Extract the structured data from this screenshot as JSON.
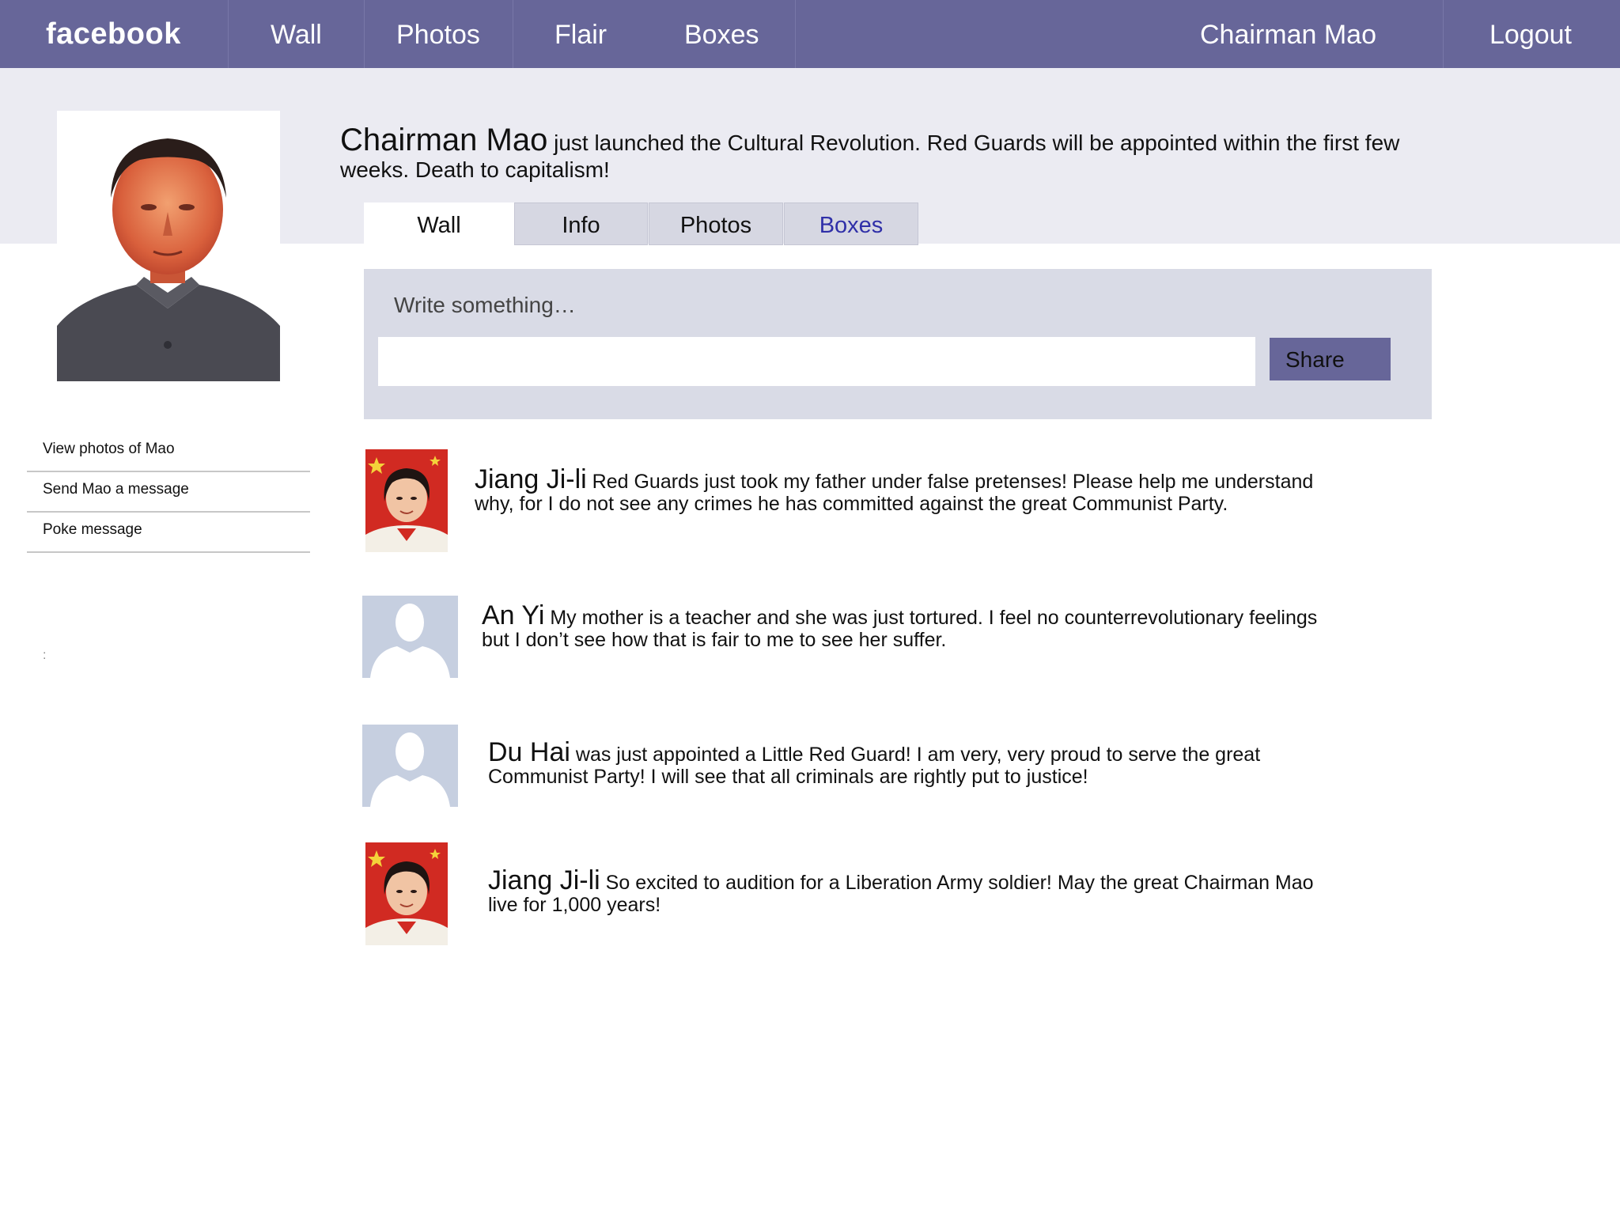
{
  "nav": {
    "logo": "facebook",
    "items": [
      "Wall",
      "Photos",
      "Flair",
      "Boxes"
    ],
    "user": "Chairman Mao",
    "logout": "Logout"
  },
  "profile": {
    "name": "Chairman Mao",
    "status": "just launched the Cultural Revolution. Red Guards will be appointed within the first few weeks. Death to capitalism!"
  },
  "tabs": [
    "Wall",
    "Info",
    "Photos",
    "Boxes"
  ],
  "sidebar": {
    "links": [
      "View photos of Mao",
      "Send Mao a message",
      "Poke message"
    ],
    "stray": ":"
  },
  "composer": {
    "label": "Write something…",
    "share": "Share"
  },
  "posts": [
    {
      "name": "Jiang Ji-li",
      "text": "Red Guards just took my father under false pretenses! Please help me understand why, for I do not see any crimes he has committed against the great Communist Party.",
      "avatar": "photo-avatar"
    },
    {
      "name": "An Yi",
      "text": "My mother is a teacher and she was just tortured. I feel no counterrevolutionary feelings but I don’t see how that is fair to me to see her suffer.",
      "avatar": "default-avatar"
    },
    {
      "name": "Du Hai",
      "text": "was just appointed a Little Red Guard! I am very, very proud to serve the great Communist Party! I will see that all criminals are rightly put to justice!",
      "avatar": "default-avatar"
    },
    {
      "name": "Jiang Ji-li",
      "text": "So excited to audition for a Liberation Army soldier! May the great Chairman Mao live for 1,000 years!",
      "avatar": "photo-avatar"
    }
  ],
  "colors": {
    "nav_bg": "#676699",
    "band_bg": "#ebebf2",
    "composer_bg": "#d9dbe6",
    "link_blue": "#2f2fa8"
  }
}
